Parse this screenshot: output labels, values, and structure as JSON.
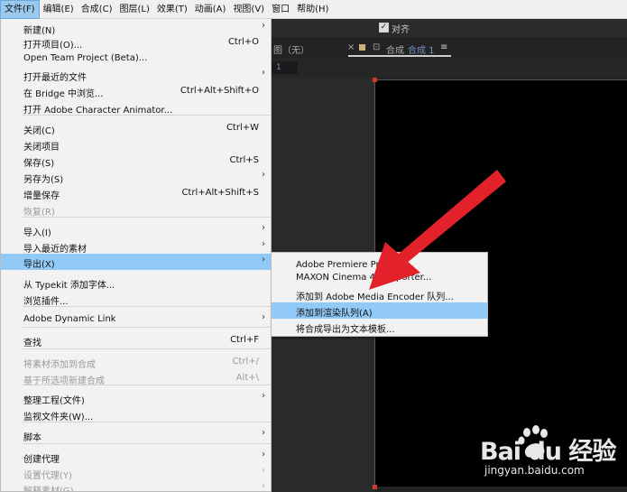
{
  "menubar": {
    "items": [
      {
        "label": "文件(F)"
      },
      {
        "label": "编辑(E)"
      },
      {
        "label": "合成(C)"
      },
      {
        "label": "图层(L)"
      },
      {
        "label": "效果(T)"
      },
      {
        "label": "动画(A)"
      },
      {
        "label": "视图(V)"
      },
      {
        "label": "窗口"
      },
      {
        "label": "帮助(H)"
      }
    ]
  },
  "toolbar": {
    "align_label": "对齐",
    "align_checked": "✓"
  },
  "panel": {
    "left_tab": "图（无）",
    "comp_tab_prefix": "合成",
    "comp_name": "合成 1",
    "frame_value": "1"
  },
  "file_menu": {
    "items": [
      {
        "label": "新建(N)",
        "shortcut": "",
        "arrow": "›"
      },
      {
        "label": "打开项目(O)...",
        "shortcut": "Ctrl+O",
        "arrow": ""
      },
      {
        "label": "Open Team Project (Beta)...",
        "shortcut": "",
        "arrow": ""
      },
      {
        "label": "打开最近的文件",
        "shortcut": "",
        "arrow": "›"
      },
      {
        "label": "在 Bridge 中浏览...",
        "shortcut": "Ctrl+Alt+Shift+O",
        "arrow": ""
      },
      {
        "label": "打开 Adobe Character Animator...",
        "shortcut": "",
        "arrow": ""
      },
      {
        "label": "关闭(C)",
        "shortcut": "Ctrl+W",
        "arrow": ""
      },
      {
        "label": "关闭项目",
        "shortcut": "",
        "arrow": ""
      },
      {
        "label": "保存(S)",
        "shortcut": "Ctrl+S",
        "arrow": ""
      },
      {
        "label": "另存为(S)",
        "shortcut": "",
        "arrow": "›"
      },
      {
        "label": "增量保存",
        "shortcut": "Ctrl+Alt+Shift+S",
        "arrow": ""
      },
      {
        "label": "恢复(R)",
        "shortcut": "",
        "arrow": ""
      },
      {
        "label": "导入(I)",
        "shortcut": "",
        "arrow": "›"
      },
      {
        "label": "导入最近的素材",
        "shortcut": "",
        "arrow": "›"
      },
      {
        "label": "导出(X)",
        "shortcut": "",
        "arrow": "›"
      },
      {
        "label": "从 Typekit 添加字体...",
        "shortcut": "",
        "arrow": ""
      },
      {
        "label": "浏览插件...",
        "shortcut": "",
        "arrow": ""
      },
      {
        "label": "Adobe Dynamic Link",
        "shortcut": "",
        "arrow": "›"
      },
      {
        "label": "查找",
        "shortcut": "Ctrl+F",
        "arrow": ""
      },
      {
        "label": "将素材添加到合成",
        "shortcut": "Ctrl+/",
        "arrow": ""
      },
      {
        "label": "基于所选项新建合成",
        "shortcut": "Alt+\\",
        "arrow": ""
      },
      {
        "label": "整理工程(文件)",
        "shortcut": "",
        "arrow": "›"
      },
      {
        "label": "监视文件夹(W)...",
        "shortcut": "",
        "arrow": ""
      },
      {
        "label": "脚本",
        "shortcut": "",
        "arrow": "›"
      },
      {
        "label": "创建代理",
        "shortcut": "",
        "arrow": "›"
      },
      {
        "label": "设置代理(Y)",
        "shortcut": "",
        "arrow": "›"
      },
      {
        "label": "解释素材(G)",
        "shortcut": "",
        "arrow": "›"
      }
    ]
  },
  "export_submenu": {
    "items": [
      {
        "label": "Adobe Premiere Pro 项目..."
      },
      {
        "label": "MAXON Cinema 4D Exporter..."
      },
      {
        "label": "添加到 Adobe Media Encoder 队列..."
      },
      {
        "label": "添加到渲染队列(A)"
      },
      {
        "label": "将合成导出为文本模板..."
      }
    ]
  },
  "watermark": {
    "logo_text": "Bai du 经验",
    "site": "jingyan.baidu.com"
  },
  "colors": {
    "highlight": "#91c9f7",
    "arrow": "#e3212b",
    "menubar_active": "#99c9ef"
  }
}
